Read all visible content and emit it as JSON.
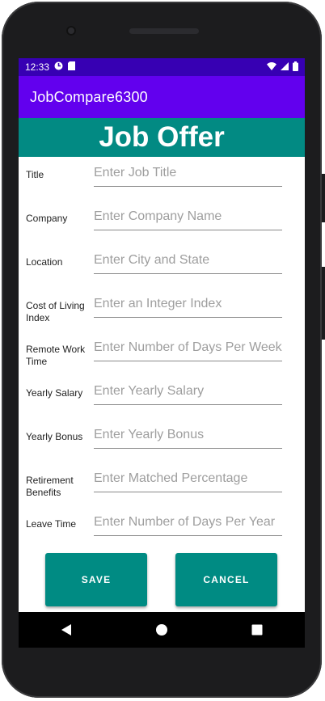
{
  "status_bar": {
    "time": "12:33",
    "icons": [
      "sync-icon",
      "sd-card-icon",
      "wifi-icon",
      "signal-icon",
      "battery-icon"
    ]
  },
  "app_bar": {
    "title": "JobCompare6300"
  },
  "banner": {
    "title": "Job Offer"
  },
  "form": {
    "fields": [
      {
        "label": "Title",
        "placeholder": "Enter Job Title"
      },
      {
        "label": "Company",
        "placeholder": "Enter Company Name"
      },
      {
        "label": "Location",
        "placeholder": "Enter City and State"
      },
      {
        "label": "Cost of Living Index",
        "placeholder": "Enter an Integer Index"
      },
      {
        "label": "Remote Work Time",
        "placeholder": "Enter Number of Days Per Week"
      },
      {
        "label": "Yearly Salary",
        "placeholder": "Enter Yearly Salary"
      },
      {
        "label": "Yearly Bonus",
        "placeholder": "Enter Yearly Bonus"
      },
      {
        "label": "Retirement Benefits",
        "placeholder": "Enter Matched Percentage"
      },
      {
        "label": "Leave Time",
        "placeholder": "Enter Number of Days Per Year"
      }
    ]
  },
  "buttons": {
    "save": "SAVE",
    "cancel": "CANCEL"
  },
  "colors": {
    "status_bar": "#3700b3",
    "app_bar": "#6200ee",
    "banner": "#028a83",
    "button": "#008b83"
  }
}
